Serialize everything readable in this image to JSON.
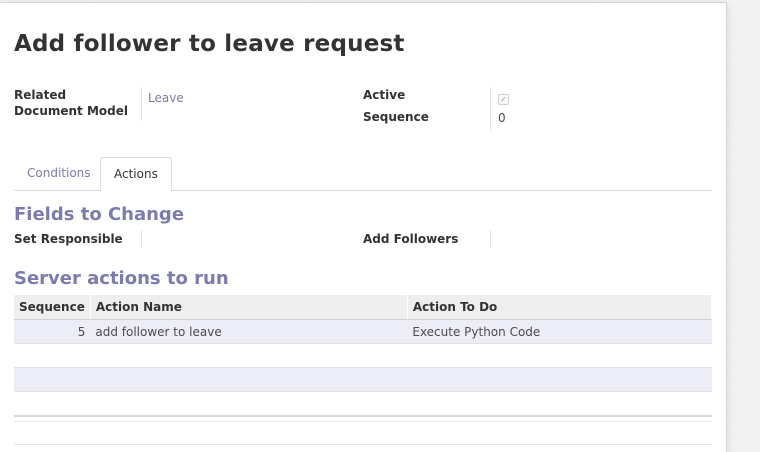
{
  "form": {
    "title": "Add follower to leave request",
    "related_model_label": "Related Document Model",
    "related_model_value": "Leave",
    "active_label": "Active",
    "active_checked": true,
    "sequence_label": "Sequence",
    "sequence_value": "0"
  },
  "tabs": [
    {
      "label": "Conditions",
      "active": false
    },
    {
      "label": "Actions",
      "active": true
    }
  ],
  "fields_to_change": {
    "heading": "Fields to Change",
    "set_responsible_label": "Set Responsible",
    "set_responsible_value": "",
    "add_followers_label": "Add Followers",
    "add_followers_value": ""
  },
  "server_actions": {
    "heading": "Server actions to run",
    "columns": [
      "Sequence",
      "Action Name",
      "Action To Do"
    ],
    "rows": [
      {
        "sequence": "5",
        "name": "add follower to leave",
        "action": "Execute Python Code"
      }
    ]
  },
  "colors": {
    "accent": "#7c7bad",
    "row_highlight": "#ecedf7"
  }
}
